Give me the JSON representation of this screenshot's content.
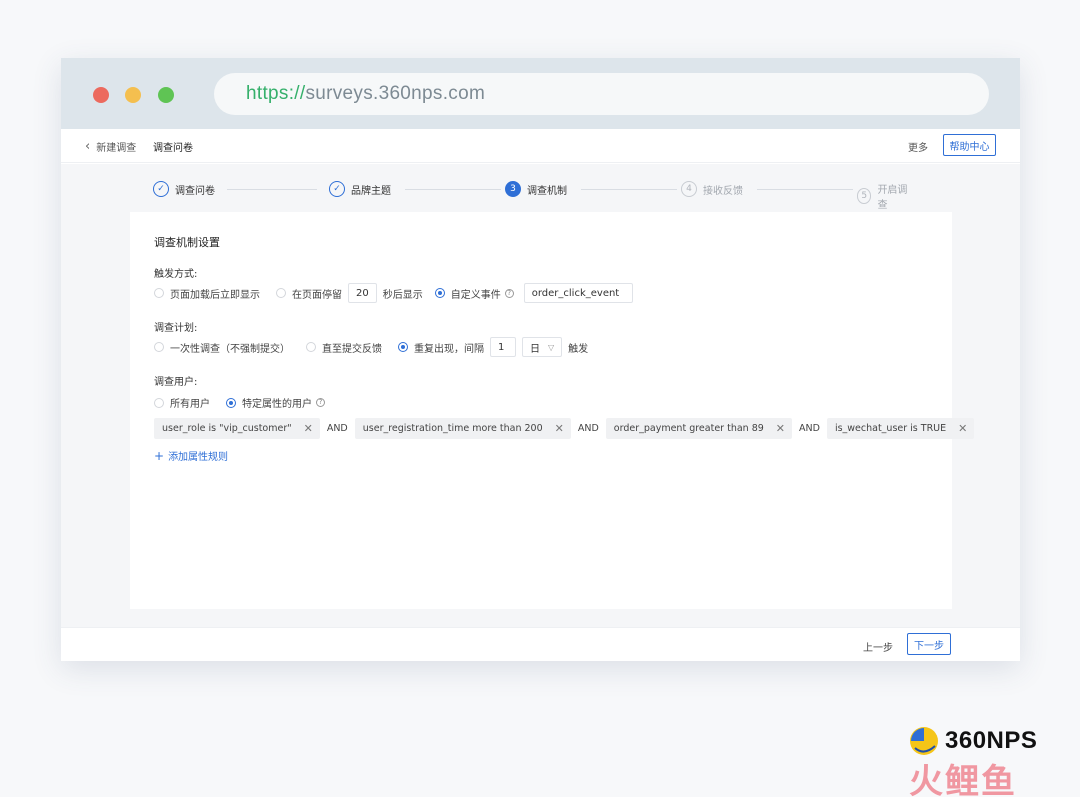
{
  "browser": {
    "url_scheme": "https://",
    "url_host": "surveys.360nps.com"
  },
  "appbar": {
    "back_label": "新建调查",
    "page_title": "调查问卷",
    "more_label": "更多",
    "help_label": "帮助中心"
  },
  "steps": [
    {
      "label": "调查问卷",
      "number": "1",
      "state": "done"
    },
    {
      "label": "品牌主题",
      "number": "2",
      "state": "done"
    },
    {
      "label": "调查机制",
      "number": "3",
      "state": "active"
    },
    {
      "label": "接收反馈",
      "number": "4",
      "state": "todo"
    },
    {
      "label": "开启调查",
      "number": "5",
      "state": "todo"
    }
  ],
  "card": {
    "title": "调查机制设置",
    "trigger": {
      "label": "触发方式:",
      "opt_pageload": "页面加载后立即显示",
      "opt_stay_before": "在页面停留",
      "stay_seconds": "20",
      "opt_stay_after": "秒后显示",
      "opt_custom": "自定义事件",
      "custom_event": "order_click_event",
      "selected": "custom"
    },
    "plan": {
      "label": "调查计划:",
      "opt_once": "一次性调查（不强制提交）",
      "opt_until": "直至提交反馈",
      "opt_repeat": "重复出现，间隔",
      "interval_value": "1",
      "interval_unit": "日",
      "opt_repeat_after": "触发",
      "selected": "repeat"
    },
    "users": {
      "label": "调查用户:",
      "opt_all": "所有用户",
      "opt_specific": "特定属性的用户",
      "selected": "specific",
      "rules": [
        "user_role is \"vip_customer\"",
        "user_registration_time more than 200",
        "order_payment greater than 89",
        "is_wechat_user is TRUE"
      ],
      "connector": "AND",
      "add_rule_label": "添加属性规则"
    }
  },
  "footer": {
    "prev_label": "上一步",
    "next_label": "下一步"
  },
  "brand": {
    "name": "360NPS",
    "sub": "火鲤鱼"
  },
  "colors": {
    "accent": "#2f6fd6",
    "url_scheme": "#35b06b",
    "brand_sub": "#f08d98"
  }
}
